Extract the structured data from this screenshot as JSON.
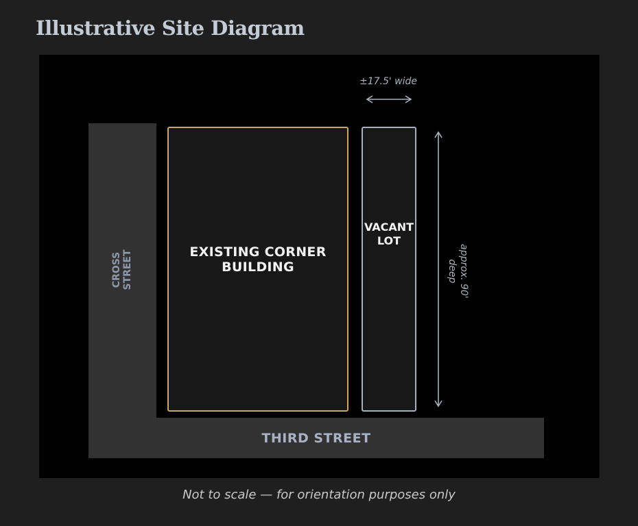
{
  "title": "Illustrative Site Diagram",
  "streets": {
    "cross_street": "CROSS STREET",
    "third_street": "THIRD STREET"
  },
  "parcels": {
    "building": "EXISTING CORNER BUILDING",
    "vacant": "VACANT LOT"
  },
  "dimensions": {
    "width": "±17.5' wide",
    "depth": "approx. 90' deep"
  },
  "caption": "Not to scale — for orientation purposes only",
  "colors": {
    "building_outline": "#c9a86a",
    "vacant_outline": "#a8afc0",
    "street_fill": "#323232",
    "background": "#000000"
  }
}
